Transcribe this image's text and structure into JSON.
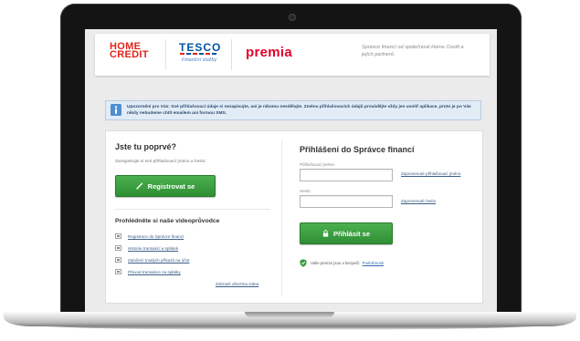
{
  "header": {
    "home_credit_logo": {
      "line1": "HOME",
      "line2": "CREDIT"
    },
    "tesco_logo": {
      "name": "TESCO",
      "subtitle": "Finanční služby"
    },
    "premia_logo": "premia",
    "tagline": "Správce financí od společnosti Home Credit a jejích partnerů."
  },
  "notice": {
    "icon": "info-icon",
    "text": "Upozornění pro Vás: Své přihlašovací údaje si nezapisujte, ani je nikomu nesdělujte. Změnu přihlašovacích údajů provádějte vždy jen uvnitř aplikace, proto je po Vás nikdy nebudeme chtít emailem ani formou SMS."
  },
  "register": {
    "heading": "Jste tu poprvé?",
    "subtitle": "Zaregistrujte si své přihlašovací jméno a heslo:",
    "button_label": "Registrovat se",
    "button_icon": "pencil-icon"
  },
  "videos": {
    "heading": "Prohlédněte si naše videoprůvodce",
    "item_icon": "video-icon",
    "items": [
      "Registrace do Správce financí",
      "Historie transakcí a splátek",
      "Založení trvalých příkazů na účet",
      "Převod transakce na splátky"
    ],
    "show_all_label": "Zobrazit všechna videa"
  },
  "login": {
    "heading": "Přihlášení do Správce financí",
    "username_label": "Přihlašovací jméno",
    "username_value": "",
    "forgot_username": "Zapomenuté přihlašovací jméno",
    "password_label": "Heslo",
    "password_value": "",
    "forgot_password": "Zapomenuté heslo",
    "button_label": "Přihlásit se",
    "button_icon": "lock-icon",
    "security_icon": "shield-icon",
    "security_text": "Vaše peníze jsou v bezpečí.",
    "security_link": "Podrobnosti"
  },
  "colors": {
    "brand_red": "#e2231a",
    "tesco_blue": "#00539f",
    "premia_red": "#e4002b",
    "button_green": "#3a9e3f",
    "notice_bg": "#e1ecf7",
    "link_blue": "#3c5f87"
  }
}
